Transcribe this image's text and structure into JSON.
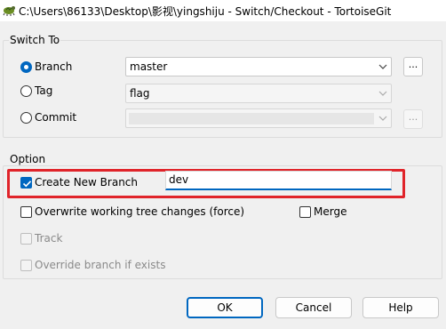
{
  "window": {
    "title": "C:\\Users\\86133\\Desktop\\影视\\yingshiju - Switch/Checkout - TortoiseGit",
    "icon": "tortoisegit-icon"
  },
  "switch_to": {
    "label": "Switch To",
    "branch": {
      "label": "Branch",
      "value": "master",
      "selected": true
    },
    "tag": {
      "label": "Tag",
      "value": "flag",
      "selected": false
    },
    "commit": {
      "label": "Commit",
      "value": "",
      "selected": false
    },
    "browse_label": "..."
  },
  "option": {
    "label": "Option",
    "create_new_branch": {
      "label": "Create New Branch",
      "checked": true,
      "value": "dev"
    },
    "overwrite": {
      "label": "Overwrite working tree changes (force)",
      "checked": false
    },
    "merge": {
      "label": "Merge",
      "checked": false
    },
    "track": {
      "label": "Track",
      "checked": false,
      "enabled": false
    },
    "override": {
      "label": "Override branch if exists",
      "checked": false,
      "enabled": false
    }
  },
  "buttons": {
    "ok": "OK",
    "cancel": "Cancel",
    "help": "Help"
  },
  "colors": {
    "accent": "#0067c0",
    "highlight": "#e0242a"
  }
}
